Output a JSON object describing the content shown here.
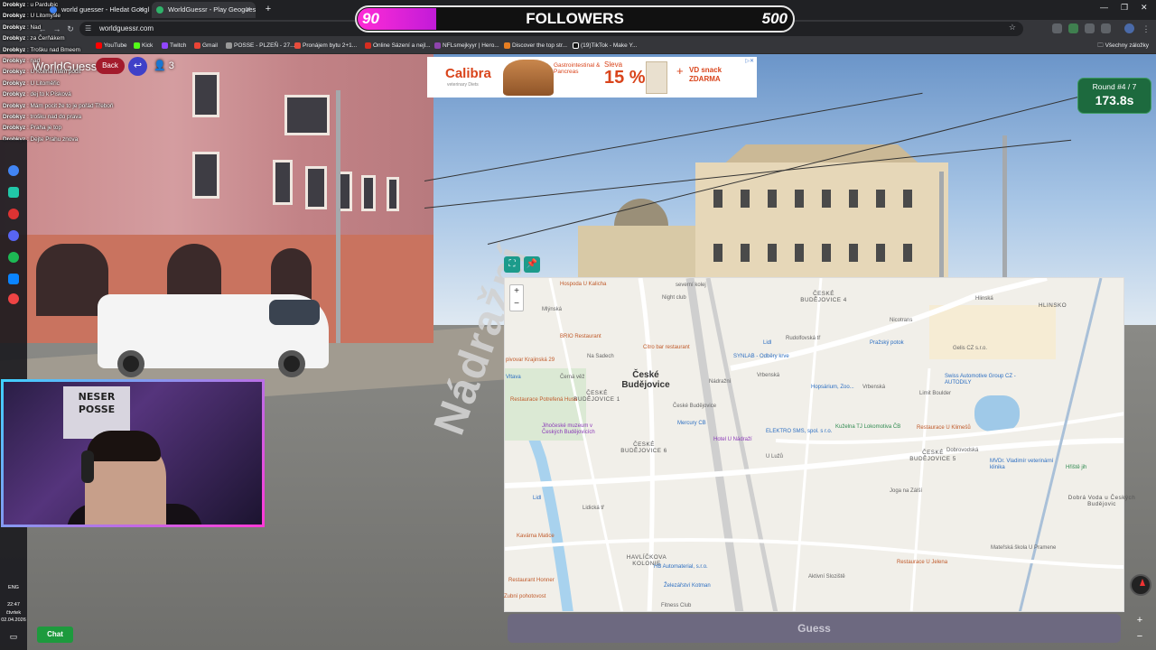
{
  "browser": {
    "tabs": [
      {
        "label": "world guesser - Hledat Google",
        "active": false
      },
      {
        "label": "WorldGuessr - Play Geoguessr",
        "active": true
      }
    ],
    "url": "worldguessr.com",
    "bookmarks": [
      "YouTube",
      "Kick",
      "Twitch",
      "Gmail",
      "POSSE - PLZEŇ - 27...",
      "Pronájem bytu 2+1...",
      "Online Sázení a nejl...",
      "NFLsmejkyyr | Hero...",
      "Discover the top str...",
      "(19)TikTok - Make Y..."
    ],
    "all_bookmarks": "Všechny záložky"
  },
  "followers": {
    "current": "90",
    "label": "FOLLOWERS",
    "goal": "500",
    "progress": 0.18
  },
  "chat": [
    {
      "user": "Drobkyz",
      "msg": "u Pardubic"
    },
    {
      "user": "Drobkyz",
      "msg": "U Litomyšle"
    },
    {
      "user": "Drobkyz",
      "msg": "Nad"
    },
    {
      "user": "Drobkyz",
      "msg": "za Čerňákem"
    },
    {
      "user": "Drobkyz",
      "msg": "Trošku nad Bmeem"
    },
    {
      "user": "Drobkyz",
      "msg": "nad"
    },
    {
      "user": "Drobkyz",
      "msg": "U Kolína mám pocit"
    },
    {
      "user": "Drobkyz",
      "msg": "U Litoměřic"
    },
    {
      "user": "Drobkyz",
      "msg": "dej to k Písková"
    },
    {
      "user": "Drobkyz",
      "msg": "Mám pocit že to je pořád Třeboň"
    },
    {
      "user": "Drobkyz",
      "msg": "trošku nad do prava"
    },
    {
      "user": "Drobkyz",
      "msg": "Praha je top"
    },
    {
      "user": "Drobkyz",
      "msg": "Dejte Prahu znova"
    }
  ],
  "game": {
    "logo": "WorldGuessr",
    "back_label": "Back",
    "players": "3",
    "round_label": "Round #4 / 7",
    "timer": "173.8s",
    "guess_label": "Guess",
    "chat_label": "Chat",
    "street_name": "Nádražní"
  },
  "ad": {
    "brand": "Calibra",
    "brand_sub": "veterinary Diets",
    "condition": "Gastrointestinal & Pancreas",
    "sleva": "Sleva",
    "percent": "15 %",
    "plus": "+",
    "offer": "VD snack ZDARMA"
  },
  "map": {
    "city": "České Budějovice",
    "labels": [
      {
        "t": "Hospoda U Kalicha",
        "c": "red"
      },
      {
        "t": "Night club",
        "c": ""
      },
      {
        "t": "severní kolej",
        "c": ""
      },
      {
        "t": "ČESKÉ BUDĚJOVICE 4",
        "c": "district"
      },
      {
        "t": "Nicotrans",
        "c": ""
      },
      {
        "t": "Hlinská",
        "c": ""
      },
      {
        "t": "HLINSKO",
        "c": "district"
      },
      {
        "t": "BRIO Restaurant",
        "c": "red"
      },
      {
        "t": "Citro bar restaurant",
        "c": "red"
      },
      {
        "t": "Lidl",
        "c": "blue"
      },
      {
        "t": "Pražský potok",
        "c": "blue"
      },
      {
        "t": "Gelis CZ s.r.o.",
        "c": ""
      },
      {
        "t": "pivovar Krajinská 29",
        "c": "red"
      },
      {
        "t": "Na Sadech",
        "c": ""
      },
      {
        "t": "SYNLAB - Odběry krve",
        "c": "blue"
      },
      {
        "t": "Swiss Automotive Group CZ - AUTODILY",
        "c": "blue"
      },
      {
        "t": "Černá věž",
        "c": ""
      },
      {
        "t": "ČESKÉ BUDĚJOVICE 1",
        "c": "district"
      },
      {
        "t": "Hopsárium, Zoo...",
        "c": "blue"
      },
      {
        "t": "Limit Boulder",
        "c": ""
      },
      {
        "t": "České Budějovice",
        "c": ""
      },
      {
        "t": "Mercury CB",
        "c": "blue"
      },
      {
        "t": "Jihočeské muzeum v Českých Budějovicích",
        "c": "purple"
      },
      {
        "t": "ELEKTRO SMS, spol. s r.o.",
        "c": "blue"
      },
      {
        "t": "Kuželna TJ Lokomotiva ČB",
        "c": "green"
      },
      {
        "t": "Restaurace U Klimešů",
        "c": "red"
      },
      {
        "t": "ČESKÉ BUDĚJOVICE 6",
        "c": "district"
      },
      {
        "t": "Hotel U Nádraží",
        "c": "purple"
      },
      {
        "t": "ČESKÉ BUDĚJOVICE 5",
        "c": "district"
      },
      {
        "t": "MVDr. Vladimír veterinární klinika",
        "c": "blue"
      },
      {
        "t": "Hřiště jih",
        "c": "green"
      },
      {
        "t": "Dobrá Voda u Českých Budějovic",
        "c": "district"
      },
      {
        "t": "Joga na Zálší",
        "c": ""
      },
      {
        "t": "Dobrovodská",
        "c": ""
      },
      {
        "t": "Lidl",
        "c": "blue"
      },
      {
        "t": "HAVLÍČKOVA KOLONIE",
        "c": "district"
      },
      {
        "t": "Kavárna Matice",
        "c": "red"
      },
      {
        "t": "Mateřská škola U Pramene",
        "c": ""
      },
      {
        "t": "HB Automaterial, s.r.o.",
        "c": "blue"
      },
      {
        "t": "Restaurace U Jelena",
        "c": "red"
      },
      {
        "t": "Restaurant Honner",
        "c": "red"
      },
      {
        "t": "Aktivní Sloziště",
        "c": ""
      },
      {
        "t": "Železářství Kotman",
        "c": "blue"
      },
      {
        "t": "Zubní pohotovost",
        "c": "red"
      },
      {
        "t": "Fitness Club",
        "c": ""
      },
      {
        "t": "Restaurace Potrefená Husa",
        "c": "red"
      },
      {
        "t": "Vltava",
        "c": "blue"
      },
      {
        "t": "Nádražní",
        "c": ""
      },
      {
        "t": "Rudolfovská tř",
        "c": ""
      },
      {
        "t": "Vrbenská",
        "c": ""
      },
      {
        "t": "Mlýnská",
        "c": ""
      },
      {
        "t": "Lidická tř",
        "c": ""
      },
      {
        "t": "U Lužů",
        "c": ""
      },
      {
        "t": "Vrbenská",
        "c": ""
      }
    ]
  },
  "taskbar": {
    "lang": "ENG",
    "time": "22:47",
    "day": "čtvrtek",
    "date": "02.04.2026"
  },
  "colors": {
    "followers_fill": "#ff2bd6",
    "round_bg": "#1d6a3e",
    "guess_bg": "#6d6980",
    "back_bg": "#a31b2c",
    "chat_bg": "#1d9a3d"
  }
}
